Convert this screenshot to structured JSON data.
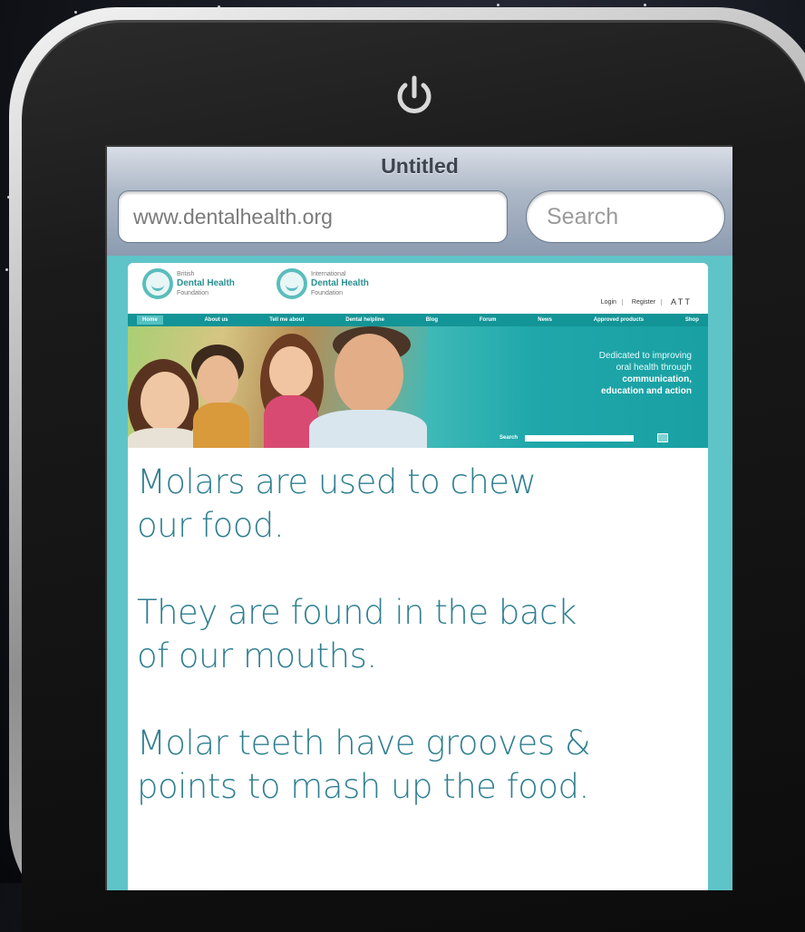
{
  "browser": {
    "title": "Untitled",
    "url": "www.dentalhealth.org",
    "search_placeholder": "Search"
  },
  "site": {
    "logos": [
      {
        "small": "British",
        "name": "Dental Health",
        "sub": "Foundation"
      },
      {
        "small": "International",
        "name": "Dental Health",
        "sub": "Foundation"
      }
    ],
    "header_links": [
      "Login",
      "Register"
    ],
    "text_size_control": "A T T",
    "nav": [
      "Home",
      "About us",
      "Tell me about",
      "Dental helpline",
      "Blog",
      "Forum",
      "News",
      "Approved products",
      "Shop"
    ],
    "banner_lines": [
      "Dedicated to improving",
      "oral health through",
      "communication,",
      "education and action"
    ],
    "banner_search_label": "Search"
  },
  "content": {
    "paragraphs": [
      "Molars are used to chew\nour food.",
      "They are found in the back\nof our mouths.",
      "Molar teeth have grooves &\npoints to mash up the food."
    ]
  },
  "colors": {
    "accent": "#139496",
    "text": "#2f7f91",
    "screen_bg": "#5fc4c8"
  },
  "icons": {
    "power": "power-icon",
    "search": "search-icon"
  }
}
